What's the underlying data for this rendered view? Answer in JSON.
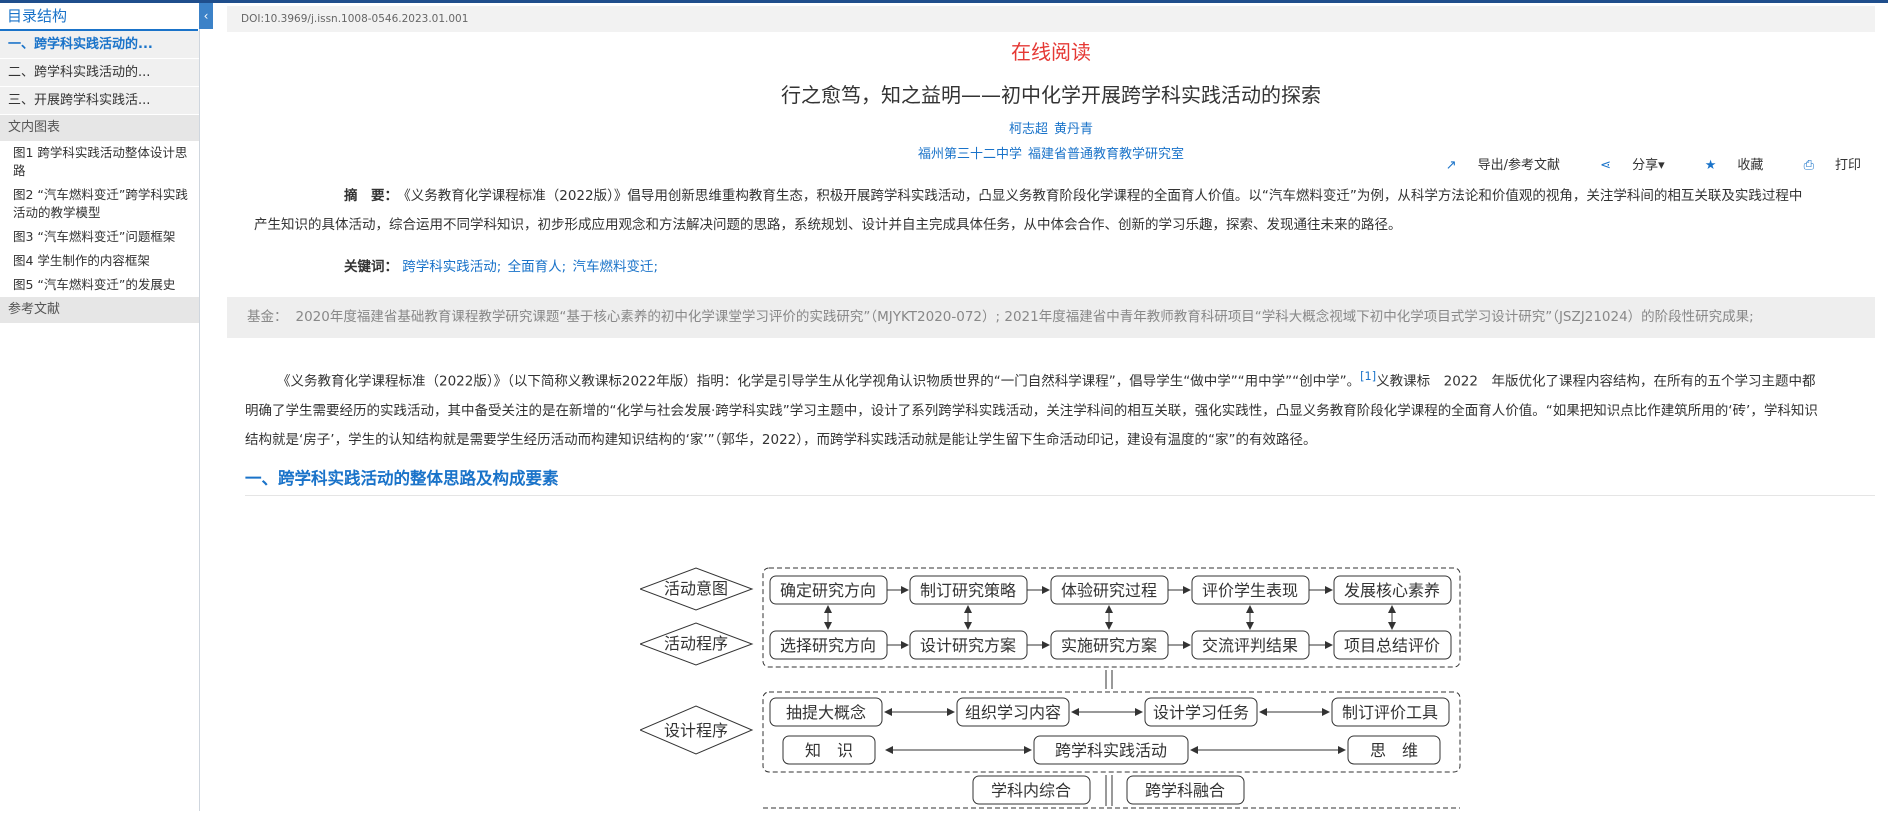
{
  "sidebar": {
    "title": "目录结构",
    "collapse_glyph": "‹",
    "toc": [
      "一、跨学科实践活动的...",
      "二、跨学科实践活动的...",
      "三、开展跨学科实践活..."
    ],
    "figures_head": "文内图表",
    "figures": [
      "图1 跨学科实践活动整体设计思路",
      "图2 “汽车燃料变迁”跨学科实践活动的教学模型",
      "图3 “汽车燃料变迁”问题框架",
      "图4 学生制作的内容框架",
      "图5 “汽车燃料变迁”的发展史"
    ],
    "refs_head": "参考文献"
  },
  "doi": "DOI:10.3969/j.issn.1008-0546.2023.01.001",
  "online_read": "在线阅读",
  "title": "行之愈笃，知之益明——初中化学开展跨学科实践活动的探索",
  "authors": [
    "柯志超",
    "黄丹青"
  ],
  "orgs": [
    "福州第三十二中学",
    "福建省普通教育教学研究室"
  ],
  "tools": {
    "export": "导出/参考文献",
    "share": "分享",
    "favorite": "收藏",
    "print": "打印"
  },
  "abstract": {
    "label": "摘　要：",
    "text": "《义务教育化学课程标准（2022版）》倡导用创新思维重构教育生态，积极开展跨学科实践活动，凸显义务教育阶段化学课程的全面育人价值。以“汽车燃料变迁”为例，从科学方法论和价值观的视角，关注学科间的相互关联及实践过程中产生知识的具体活动，综合运用不同学科知识，初步形成应用观念和方法解决问题的思路，系统规划、设计并自主完成具体任务，从中体会合作、创新的学习乐趣，探索、发现通往未来的路径。"
  },
  "keywords": {
    "label": "关键词：",
    "items": [
      "跨学科实践活动;",
      "全面育人;",
      "汽车燃料变迁;"
    ]
  },
  "fund": {
    "label": "基金：",
    "text": "2020年度福建省基础教育课程教学研究课题“基于核心素养的初中化学课堂学习评价的实践研究”（MJYKT2020-072）; 2021年度福建省中青年教师教育科研项目“学科大概念视域下初中化学项目式学习设计研究”（JSZJ21024）的阶段性研究成果;"
  },
  "body": {
    "text_a": "《义务教育化学课程标准（2022版）》（以下简称义教课标2022年版）指明：化学是引导学生从化学视角认识物质世界的“一门自然科学课程”，倡导学生“做中学”“用中学”“创中学”。",
    "ref": "[1]",
    "text_b": "义教课标　2022　年版优化了课程内容结构，在所有的五个学习主题中都明确了学生需要经历的实践活动，其中备受关注的是在新增的“化学与社会发展·跨学科实践”学习主题中，设计了系列跨学科实践活动，关注学科间的相互关联，强化实践性，凸显义务教育阶段化学课程的全面育人价值。“如果把知识点比作建筑所用的‘砖’，学科知识结构就是‘房子’，学生的认知结构就是需要学生经历活动而构建知识结构的‘家’”（郭华，2022），而跨学科实践活动就是能让学生留下生命活动印记，建设有温度的“家”的有效路径。"
  },
  "section1": "一、跨学科实践活动的整体思路及构成要素",
  "diagram": {
    "diamonds": [
      "活动意图",
      "活动程序",
      "设计程序"
    ],
    "row1": [
      "确定研究方向",
      "制订研究策略",
      "体验研究过程",
      "评价学生表现",
      "发展核心素养"
    ],
    "row2": [
      "选择研究方向",
      "设计研究方案",
      "实施研究方案",
      "交流评判结果",
      "项目总结评价"
    ],
    "row3": [
      "抽提大概念",
      "组织学习内容",
      "设计学习任务",
      "制订评价工具"
    ],
    "row4": [
      "知　识",
      "跨学科实践活动",
      "思　维"
    ],
    "row5": [
      "学科内综合",
      "跨学科融合"
    ]
  }
}
